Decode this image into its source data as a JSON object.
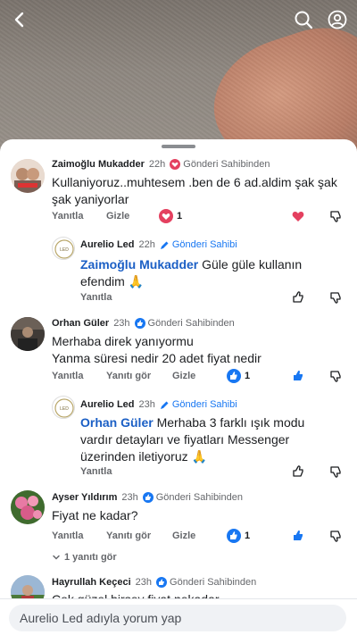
{
  "topbar": {
    "back_icon": "chevron-left-icon",
    "search_icon": "search-icon",
    "account_icon": "account-icon"
  },
  "comments": [
    {
      "name": "Zaimoğlu Mukadder",
      "time": "22h",
      "badge": "Gönderi Sahibinden",
      "text": "Kullaniyoruz..muhtesem .ben de 6 ad.aldim şak şak şak yaniyorlar",
      "reply": "Yanıtla",
      "hide": "Gizle",
      "reactions": "1"
    },
    {
      "name": "Aurelio Led",
      "time": "22h",
      "badge": "Gönderi Sahibi",
      "mention": "Zaimoğlu Mukadder",
      "text": "Güle güle kullanın efendim 🙏",
      "reply": "Yanıtla"
    },
    {
      "name": "Orhan Güler",
      "time": "23h",
      "badge": "Gönderi Sahibinden",
      "text_line1": "Merhaba direk yanıyormu",
      "text_line2": "Yanma süresi nedir 20 adet fiyat nedir",
      "reply": "Yanıtla",
      "see_reply": "Yanıtı gör",
      "hide": "Gizle",
      "reactions": "1"
    },
    {
      "name": "Aurelio Led",
      "time": "23h",
      "badge": "Gönderi Sahibi",
      "mention": "Orhan Güler",
      "text": "Merhaba 3 farklı ışık modu vardır detayları ve fiyatları Messenger üzerinden iletiyoruz 🙏",
      "reply": "Yanıtla"
    },
    {
      "name": "Ayser Yıldırım",
      "time": "23h",
      "badge": "Gönderi Sahibinden",
      "text": "Fiyat ne kadar?",
      "reply": "Yanıtla",
      "see_reply": "Yanıtı gör",
      "hide": "Gizle",
      "reactions": "1",
      "replies_toggle": "1 yanıtı gör"
    },
    {
      "name": "Hayrullah Keçeci",
      "time": "23h",
      "badge": "Gönderi Sahibinden",
      "text": "Çok güzel birşey fiyat nekadar"
    }
  ],
  "composer": {
    "placeholder": "Aurelio Led adıyla yorum yap"
  },
  "colors": {
    "accent": "#1877f2",
    "heart": "#e4405f"
  }
}
